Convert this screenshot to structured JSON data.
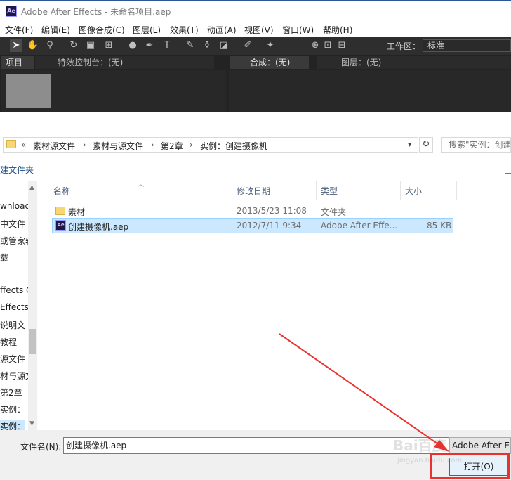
{
  "app": {
    "title": "Adobe After Effects - 未命名项目.aep",
    "logo": "Ae"
  },
  "menu": [
    "文件(F)",
    "编辑(E)",
    "图像合成(C)",
    "图层(L)",
    "效果(T)",
    "动画(A)",
    "视图(V)",
    "窗口(W)",
    "帮助(H)"
  ],
  "toolbar": {
    "workspace_label": "工作区：",
    "workspace_value": "标准"
  },
  "panels": {
    "project_tab": "项目",
    "effects_tab": "特效控制台：(无)",
    "comp_tab": "合成：(无)",
    "layer_tab": "图层：(无)"
  },
  "dialog": {
    "breadcrumbs": [
      "素材源文件",
      "素材与源文件",
      "第2章",
      "实例：创建摄像机"
    ],
    "search_placeholder": "搜索\"实例：创建...",
    "new_folder": "建文件夹",
    "columns": [
      "名称",
      "修改日期",
      "类型",
      "大小"
    ],
    "files": [
      {
        "name": "素材",
        "date": "2013/5/23 11:08",
        "type": "文件夹",
        "size": "",
        "icon": "folder-icon"
      },
      {
        "name": "创建摄像机.aep",
        "date": "2012/7/11 9:34",
        "type": "Adobe After Effe...",
        "size": "85 KB",
        "icon": "ae-file-icon"
      }
    ],
    "nav_items": [
      "wnload",
      "中文件",
      "或管家辐",
      "载",
      "",
      "ffects C",
      "Effects",
      "说明文",
      "教程",
      "源文件",
      "材与源文",
      "第2章",
      "实例：",
      "实例："
    ],
    "filename_label": "文件名(N):",
    "filename_value": "创建摄像机.aep",
    "filetype_value": "Adobe After Effects",
    "open_button": "打开(O)"
  },
  "watermark": {
    "text": "Bai百度",
    "sub": "jingyan.baidu.com"
  },
  "colors": {
    "accent_red": "#e8322f",
    "selection": "#cce8ff",
    "ae_purple": "#1f1747"
  }
}
